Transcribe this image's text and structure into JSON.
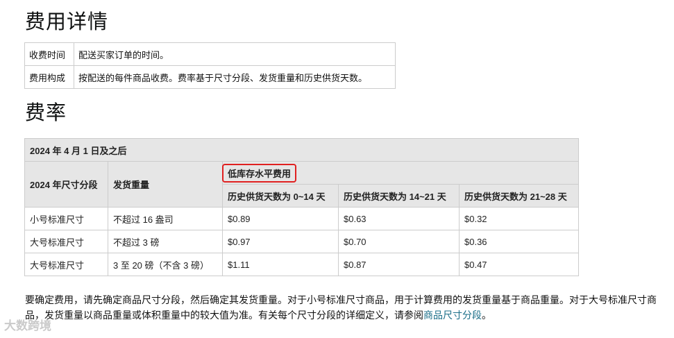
{
  "headings": {
    "fee_details": "费用详情",
    "rates": "费率"
  },
  "info_table": [
    {
      "key": "收费时间",
      "value": "配送买家订单的时间。"
    },
    {
      "key": "费用构成",
      "value": "按配送的每件商品收费。费率基于尺寸分段、发货重量和历史供货天数。"
    }
  ],
  "rate_table": {
    "caption": "2024 年 4 月 1 日及之后",
    "col_size": "2024 年尺寸分段",
    "col_weight": "发货重量",
    "group_header": "低库存水平费用",
    "sub_headers": [
      "历史供货天数为 0~14 天",
      "历史供货天数为 14~21 天",
      "历史供货天数为 21~28 天"
    ],
    "rows": [
      {
        "size": "小号标准尺寸",
        "weight": "不超过 16 盎司",
        "c1": "$0.89",
        "c2": "$0.63",
        "c3": "$0.32"
      },
      {
        "size": "大号标准尺寸",
        "weight": "不超过 3 磅",
        "c1": "$0.97",
        "c2": "$0.70",
        "c3": "$0.36"
      },
      {
        "size": "大号标准尺寸",
        "weight": "3 至 20 磅（不含 3 磅）",
        "c1": "$1.11",
        "c2": "$0.87",
        "c3": "$0.47"
      }
    ]
  },
  "paragraph": {
    "text": "要确定费用，请先确定商品尺寸分段，然后确定其发货重量。对于小号标准尺寸商品，用于计算费用的发货重量基于商品重量。对于大号标准尺寸商品，发货重量以商品重量或体积重量中的较大值为准。有关每个尺寸分段的详细定义，请参阅",
    "link": "商品尺寸分段",
    "end": "。"
  },
  "watermark": "大数跨境"
}
